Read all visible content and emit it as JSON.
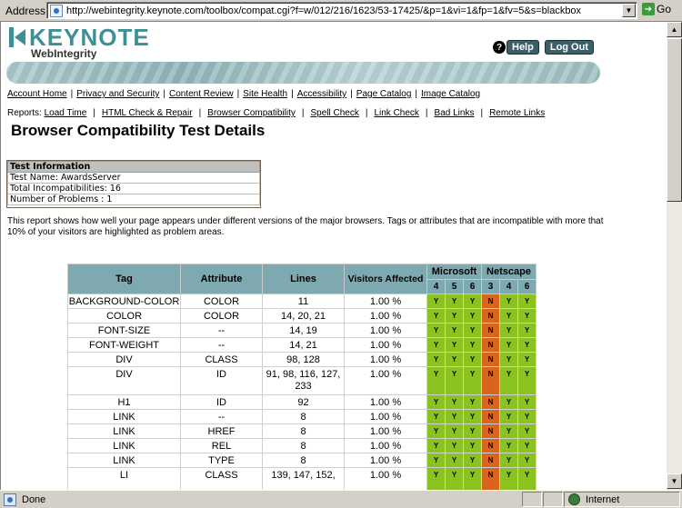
{
  "browser": {
    "address_label": "Address",
    "url": "http://webintegrity.keynote.com/toolbox/compat.cgi?f=w/012/216/1623/53-17425/&p=1&vi=1&fp=1&fv=5&s=blackbox",
    "go_label": "Go",
    "status_text": "Done",
    "zone_text": "Internet"
  },
  "header": {
    "logo_main": "KEYNOTE",
    "logo_sub": "WebIntegrity",
    "help_label": "Help",
    "logout_label": "Log Out"
  },
  "nav_main": [
    "Account Home",
    "Privacy and Security",
    "Content Review",
    "Site Health",
    "Accessibility",
    "Page Catalog",
    "Image Catalog"
  ],
  "nav_reports": {
    "label": "Reports:",
    "items": [
      "Load Time",
      "HTML Check & Repair",
      "Browser Compatibility",
      "Spell Check",
      "Link Check",
      "Bad Links",
      "Remote Links"
    ]
  },
  "page_title": "Browser Compatibility Test Details",
  "test_info": {
    "heading": "Test Information",
    "rows": [
      "Test Name: AwardsServer",
      "Total Incompatibilities: 16",
      "Number of Problems : 1"
    ]
  },
  "description": "This report shows how well your page appears under different versions of the major browsers. Tags or attributes that are incompatible with more that 10% of your visitors are highlighted as problem areas.",
  "table": {
    "headers": {
      "tag": "Tag",
      "attribute": "Attribute",
      "lines": "Lines",
      "visitors": "Visitors Affected",
      "microsoft": "Microsoft",
      "netscape": "Netscape"
    },
    "microsoft_versions": [
      "4",
      "5",
      "6"
    ],
    "netscape_versions": [
      "3",
      "4",
      "6"
    ],
    "rows": [
      {
        "tag": "BACKGROUND-COLOR",
        "attribute": "COLOR",
        "lines": "11",
        "visitors": "1.00 %",
        "ms": [
          "Y",
          "Y",
          "Y"
        ],
        "ns": [
          "N",
          "Y",
          "Y"
        ]
      },
      {
        "tag": "COLOR",
        "attribute": "COLOR",
        "lines": "14, 20, 21",
        "visitors": "1.00 %",
        "ms": [
          "Y",
          "Y",
          "Y"
        ],
        "ns": [
          "N",
          "Y",
          "Y"
        ]
      },
      {
        "tag": "FONT-SIZE",
        "attribute": "--",
        "lines": "14, 19",
        "visitors": "1.00 %",
        "ms": [
          "Y",
          "Y",
          "Y"
        ],
        "ns": [
          "N",
          "Y",
          "Y"
        ]
      },
      {
        "tag": "FONT-WEIGHT",
        "attribute": "--",
        "lines": "14, 21",
        "visitors": "1.00 %",
        "ms": [
          "Y",
          "Y",
          "Y"
        ],
        "ns": [
          "N",
          "Y",
          "Y"
        ]
      },
      {
        "tag": "DIV",
        "attribute": "CLASS",
        "lines": "98, 128",
        "visitors": "1.00 %",
        "ms": [
          "Y",
          "Y",
          "Y"
        ],
        "ns": [
          "N",
          "Y",
          "Y"
        ]
      },
      {
        "tag": "DIV",
        "attribute": "ID",
        "lines": "91, 98, 116, 127, 233",
        "visitors": "1.00 %",
        "ms": [
          "Y",
          "Y",
          "Y"
        ],
        "ns": [
          "N",
          "Y",
          "Y"
        ]
      },
      {
        "tag": "H1",
        "attribute": "ID",
        "lines": "92",
        "visitors": "1.00 %",
        "ms": [
          "Y",
          "Y",
          "Y"
        ],
        "ns": [
          "N",
          "Y",
          "Y"
        ]
      },
      {
        "tag": "LINK",
        "attribute": "--",
        "lines": "8",
        "visitors": "1.00 %",
        "ms": [
          "Y",
          "Y",
          "Y"
        ],
        "ns": [
          "N",
          "Y",
          "Y"
        ]
      },
      {
        "tag": "LINK",
        "attribute": "HREF",
        "lines": "8",
        "visitors": "1.00 %",
        "ms": [
          "Y",
          "Y",
          "Y"
        ],
        "ns": [
          "N",
          "Y",
          "Y"
        ]
      },
      {
        "tag": "LINK",
        "attribute": "REL",
        "lines": "8",
        "visitors": "1.00 %",
        "ms": [
          "Y",
          "Y",
          "Y"
        ],
        "ns": [
          "N",
          "Y",
          "Y"
        ]
      },
      {
        "tag": "LINK",
        "attribute": "TYPE",
        "lines": "8",
        "visitors": "1.00 %",
        "ms": [
          "Y",
          "Y",
          "Y"
        ],
        "ns": [
          "N",
          "Y",
          "Y"
        ]
      },
      {
        "tag": "LI",
        "attribute": "CLASS",
        "lines": "139, 147, 152,",
        "visitors": "1.00 %",
        "ms": [
          "Y",
          "Y",
          "Y"
        ],
        "ns": [
          "N",
          "Y",
          "Y"
        ]
      }
    ]
  },
  "colors": {
    "compatible": "#8cc220",
    "incompatible": "#d9641e",
    "header": "#7fa9b0",
    "brand": "#3f8f96"
  }
}
